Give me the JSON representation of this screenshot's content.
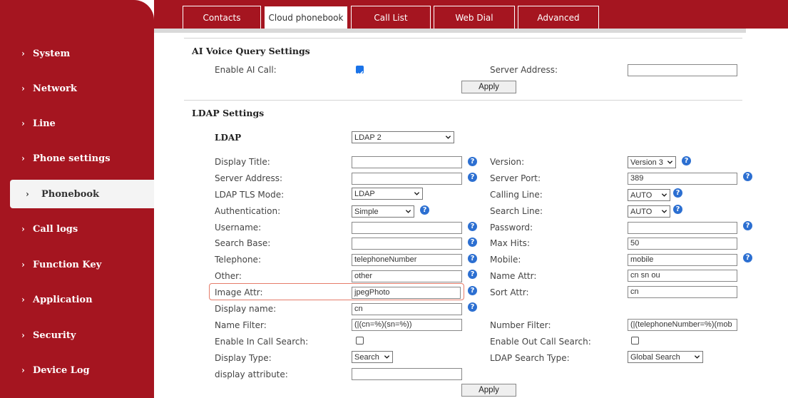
{
  "sidebar": {
    "items": [
      {
        "label": "System"
      },
      {
        "label": "Network"
      },
      {
        "label": "Line"
      },
      {
        "label": "Phone settings"
      },
      {
        "label": "Phonebook"
      },
      {
        "label": "Call logs"
      },
      {
        "label": "Function Key"
      },
      {
        "label": "Application"
      },
      {
        "label": "Security"
      },
      {
        "label": "Device Log"
      }
    ],
    "active_item": "Phonebook"
  },
  "tabs": [
    {
      "label": "Contacts"
    },
    {
      "label": "Cloud phonebook"
    },
    {
      "label": "Call List"
    },
    {
      "label": "Web Dial"
    },
    {
      "label": "Advanced"
    }
  ],
  "active_tab": "Cloud phonebook",
  "ai_voice": {
    "title": "AI Voice Query Settings",
    "enable_label": "Enable AI Call:",
    "enable_checked": true,
    "server_label": "Server Address:",
    "server_value": "",
    "apply_label": "Apply"
  },
  "ldap": {
    "title": "LDAP Settings",
    "ldap_label": "LDAP",
    "ldap_value": "LDAP 2",
    "display_title_label": "Display Title:",
    "display_title_value": "",
    "version_label": "Version:",
    "version_value": "Version 3",
    "server_address_label": "Server Address:",
    "server_address_value": "",
    "server_port_label": "Server Port:",
    "server_port_value": "389",
    "tls_label": "LDAP TLS Mode:",
    "tls_value": "LDAP",
    "calling_line_label": "Calling Line:",
    "calling_line_value": "AUTO",
    "auth_label": "Authentication:",
    "auth_value": "Simple",
    "search_line_label": "Search Line:",
    "search_line_value": "AUTO",
    "username_label": "Username:",
    "username_value": "",
    "password_label": "Password:",
    "password_value": "",
    "search_base_label": "Search Base:",
    "search_base_value": "",
    "max_hits_label": "Max Hits:",
    "max_hits_value": "50",
    "telephone_label": "Telephone:",
    "telephone_value": "telephoneNumber",
    "mobile_label": "Mobile:",
    "mobile_value": "mobile",
    "other_label": "Other:",
    "other_value": "other",
    "name_attr_label": "Name Attr:",
    "name_attr_value": "cn sn ou",
    "image_attr_label": "Image Attr:",
    "image_attr_value": "jpegPhoto",
    "sort_attr_label": "Sort Attr:",
    "sort_attr_value": "cn",
    "display_name_label": "Display name:",
    "display_name_value": "cn",
    "name_filter_label": "Name Filter:",
    "name_filter_value": "(|(cn=%)(sn=%))",
    "number_filter_label": "Number Filter:",
    "number_filter_value": "(|(telephoneNumber=%)(mob",
    "in_call_search_label": "Enable In Call Search:",
    "in_call_search_checked": false,
    "out_call_search_label": "Enable Out Call Search:",
    "out_call_search_checked": false,
    "display_type_label": "Display Type:",
    "display_type_value": "Search",
    "search_type_label": "LDAP Search Type:",
    "search_type_value": "Global Search",
    "display_attribute_label": "display attribute:",
    "display_attribute_value": "",
    "apply_label": "Apply"
  },
  "help_glyph": "?",
  "colors": {
    "brand": "#a51520",
    "help": "#2c6fd1",
    "checkbox": "#1a73e8",
    "highlight": "#e57c6a"
  }
}
